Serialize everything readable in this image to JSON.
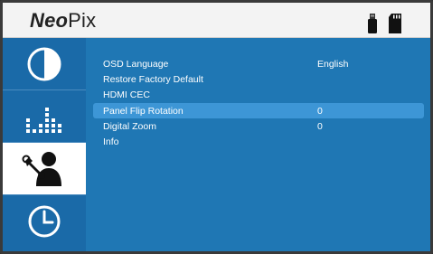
{
  "header": {
    "logo_bold": "Neo",
    "logo_regular": "Pix",
    "status_icons": [
      "usb-drive-icon",
      "sd-card-icon"
    ]
  },
  "sidebar": {
    "tabs": [
      {
        "name": "picture",
        "icon": "contrast-icon",
        "active": false
      },
      {
        "name": "sound",
        "icon": "equalizer-icon",
        "active": false
      },
      {
        "name": "settings",
        "icon": "settings-person-icon",
        "active": true
      },
      {
        "name": "time",
        "icon": "clock-icon",
        "active": false
      }
    ]
  },
  "menu": {
    "selected_index": 3,
    "items": [
      {
        "label": "OSD Language",
        "value": "English"
      },
      {
        "label": "Restore Factory Default",
        "value": ""
      },
      {
        "label": "HDMI CEC",
        "value": ""
      },
      {
        "label": "Panel Flip Rotation",
        "value": "0"
      },
      {
        "label": "Digital Zoom",
        "value": "0"
      },
      {
        "label": "Info",
        "value": ""
      }
    ]
  },
  "colors": {
    "accent": "#1f77b4",
    "sidebar": "#1a6aa8",
    "highlight": "#3d96d6",
    "header_bg": "#f3f3f3"
  }
}
